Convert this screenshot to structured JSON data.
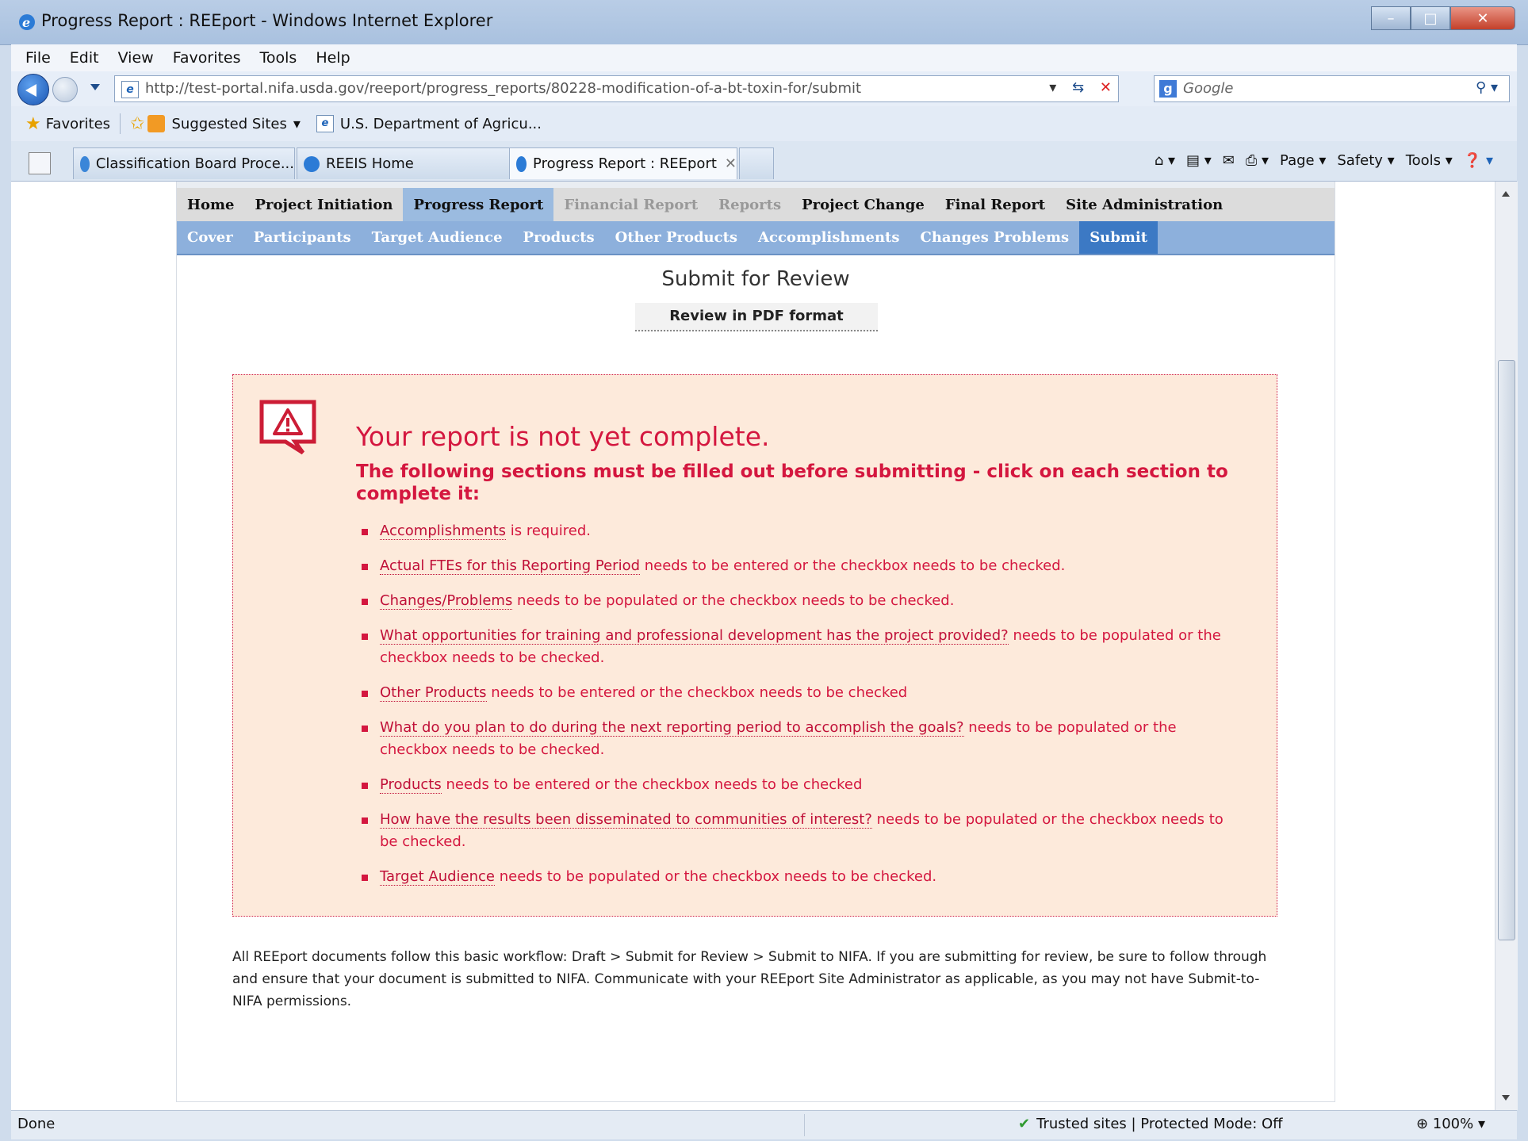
{
  "window": {
    "title": "Progress Report : REEport - Windows Internet Explorer",
    "controls": {
      "minimize": "–",
      "maximize": "□",
      "close": "✕"
    }
  },
  "menu": [
    "File",
    "Edit",
    "View",
    "Favorites",
    "Tools",
    "Help"
  ],
  "address": {
    "url": "http://test-portal.nifa.usda.gov/reeport/progress_reports/80228-modification-of-a-bt-toxin-for/submit",
    "search_placeholder": "Google"
  },
  "favorites_bar": {
    "favorites_label": "Favorites",
    "suggested_sites": "Suggested Sites",
    "usda_link": "U.S. Department of Agricu..."
  },
  "tabs": [
    {
      "label": "Classification Board Proce...",
      "active": false
    },
    {
      "label": "REEIS Home",
      "active": false
    },
    {
      "label": "Progress Report : REEport",
      "active": true
    }
  ],
  "command_bar": {
    "page": "Page",
    "safety": "Safety",
    "tools": "Tools"
  },
  "primary_nav": [
    {
      "label": "Home",
      "state": "normal"
    },
    {
      "label": "Project Initiation",
      "state": "normal"
    },
    {
      "label": "Progress Report",
      "state": "active"
    },
    {
      "label": "Financial Report",
      "state": "disabled"
    },
    {
      "label": "Reports",
      "state": "disabled"
    },
    {
      "label": "Project Change",
      "state": "normal"
    },
    {
      "label": "Final Report",
      "state": "normal"
    },
    {
      "label": "Site Administration",
      "state": "normal"
    }
  ],
  "secondary_nav": [
    {
      "label": "Cover",
      "active": false
    },
    {
      "label": "Participants",
      "active": false
    },
    {
      "label": "Target Audience",
      "active": false
    },
    {
      "label": "Products",
      "active": false
    },
    {
      "label": "Other Products",
      "active": false
    },
    {
      "label": "Accomplishments",
      "active": false
    },
    {
      "label": "Changes Problems",
      "active": false
    },
    {
      "label": "Submit",
      "active": true
    }
  ],
  "page": {
    "title": "Submit for Review",
    "pdf_button": "Review in PDF format"
  },
  "alert": {
    "heading": "Your report is not yet complete.",
    "subheading": "The following sections must be filled out before submitting - click on each section to complete it:",
    "items": [
      {
        "link": "Accomplishments",
        "text": " is required."
      },
      {
        "link": "Actual FTEs for this Reporting Period",
        "text": " needs to be entered or the checkbox needs to be checked."
      },
      {
        "link": "Changes/Problems",
        "text": " needs to be populated or the checkbox needs to be checked."
      },
      {
        "link": "What opportunities for training and professional development has the project provided?",
        "text": " needs to be populated or the checkbox needs to be checked."
      },
      {
        "link": "Other Products",
        "text": " needs to be entered or the checkbox needs to be checked"
      },
      {
        "link": "What do you plan to do during the next reporting period to accomplish the goals?",
        "text": " needs to be populated or the checkbox needs to be checked."
      },
      {
        "link": "Products",
        "text": " needs to be entered or the checkbox needs to be checked"
      },
      {
        "link": "How have the results been disseminated to communities of interest?",
        "text": " needs to be populated or the checkbox needs to be checked."
      },
      {
        "link": "Target Audience",
        "text": " needs to be populated or the checkbox needs to be checked."
      }
    ]
  },
  "workflow_note": "All REEport documents follow this basic workflow:  Draft > Submit for Review > Submit to NIFA.  If you are submitting for review, be sure to follow through and ensure that your document is submitted to NIFA.  Communicate with your REEport Site Administrator as applicable, as you may not have Submit-to-NIFA permissions.",
  "status_bar": {
    "status": "Done",
    "zone": "Trusted sites | Protected Mode: Off",
    "zoom": "100%"
  }
}
